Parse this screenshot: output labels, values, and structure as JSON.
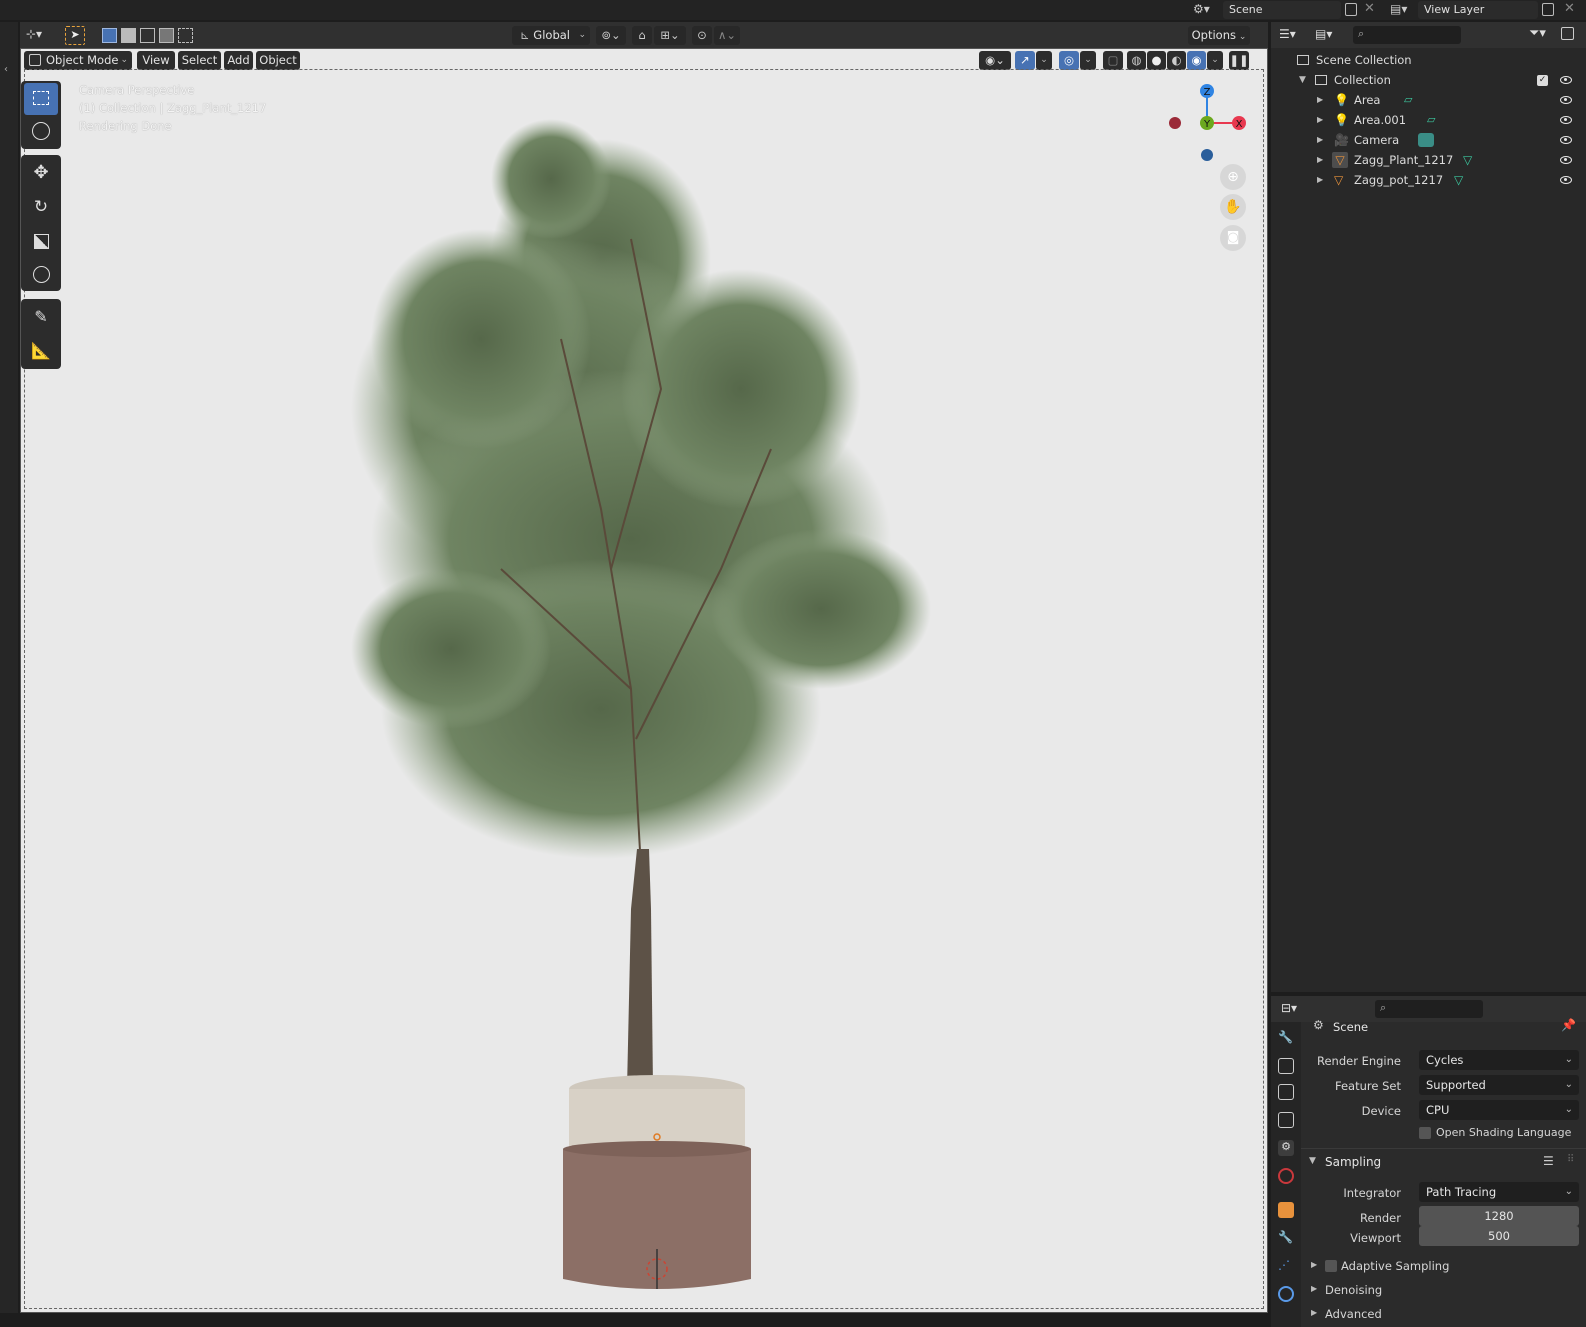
{
  "topbar": {
    "scene_label": "Scene",
    "view_layer_label": "View Layer"
  },
  "viewport_header": {
    "transform_orientation": "Global",
    "options_label": "Options",
    "mode": "Object Mode",
    "menus": [
      "View",
      "Select",
      "Add",
      "Object"
    ]
  },
  "viewport": {
    "overlay_lines": [
      "Camera Perspective",
      "(1) Collection | Zagg_Plant_1217",
      "Rendering Done"
    ],
    "axes": {
      "x": "X",
      "y": "Y",
      "z": "Z"
    }
  },
  "outliner": {
    "root": "Scene Collection",
    "collection": "Collection",
    "items": [
      {
        "name": "Area",
        "type": "light"
      },
      {
        "name": "Area.001",
        "type": "light"
      },
      {
        "name": "Camera",
        "type": "camera"
      },
      {
        "name": "Zagg_Plant_1217",
        "type": "mesh"
      },
      {
        "name": "Zagg_pot_1217",
        "type": "mesh"
      }
    ]
  },
  "properties": {
    "context": "Scene",
    "render_engine_label": "Render Engine",
    "render_engine": "Cycles",
    "feature_set_label": "Feature Set",
    "feature_set": "Supported",
    "device_label": "Device",
    "device": "CPU",
    "osl_label": "Open Shading Language",
    "sampling_label": "Sampling",
    "integrator_label": "Integrator",
    "integrator": "Path Tracing",
    "render_label": "Render",
    "render_samples": "1280",
    "viewport_label": "Viewport",
    "viewport_samples": "500",
    "adaptive_label": "Adaptive Sampling",
    "denoising_label": "Denoising",
    "advanced_label": "Advanced"
  },
  "colors": {
    "accent_blue": "#4772b3",
    "axis_x": "#e8384f",
    "axis_y": "#6ba81e",
    "axis_z": "#2f84e3",
    "viewport_bg": "#e9e9e9",
    "mesh_orange": "#e08a3c"
  }
}
